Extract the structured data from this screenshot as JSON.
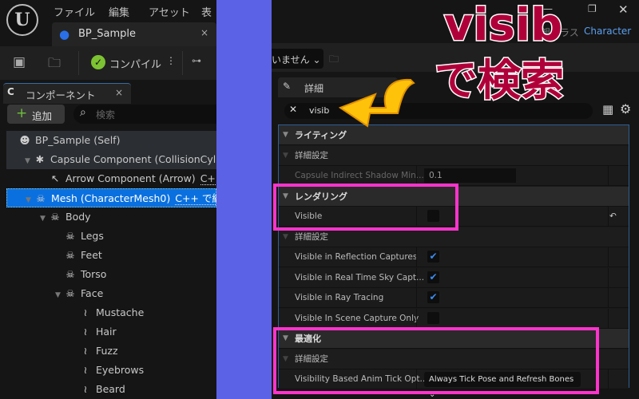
{
  "menu": [
    "ファイル",
    "編集",
    "アセット",
    "表示"
  ],
  "tab": {
    "title": "BP_Sample",
    "close": "×"
  },
  "toolbar": {
    "compile": "コンパイル",
    "more": "⋮",
    "dropdown": "いません"
  },
  "components": {
    "title": "コンポーネント",
    "close": "×",
    "add": "追加",
    "search_placeholder": "検索"
  },
  "tree": [
    {
      "label": "BP_Sample (Self)",
      "indent": 0,
      "icon": "person-icon"
    },
    {
      "label": "Capsule Component (CollisionCylinder)",
      "indent": 1,
      "icon": "capsule-icon",
      "tri": true
    },
    {
      "label": "Arrow Component (Arrow)",
      "indent": 2,
      "icon": "arrow-icon",
      "cpp": "C++ で編集"
    },
    {
      "label": "Mesh (CharacterMesh0)",
      "indent": 1,
      "icon": "skeleton-icon",
      "tri": true,
      "selected": true,
      "cpp": "C++ で編集"
    },
    {
      "label": "Body",
      "indent": 2,
      "icon": "skeleton-icon",
      "tri": true
    },
    {
      "label": "Legs",
      "indent": 3,
      "icon": "skeleton-icon"
    },
    {
      "label": "Feet",
      "indent": 3,
      "icon": "skeleton-icon"
    },
    {
      "label": "Torso",
      "indent": 3,
      "icon": "skeleton-icon"
    },
    {
      "label": "Face",
      "indent": 3,
      "icon": "skeleton-icon",
      "tri": true
    },
    {
      "label": "Mustache",
      "indent": 4,
      "icon": "hair-icon"
    },
    {
      "label": "Hair",
      "indent": 4,
      "icon": "hair-icon"
    },
    {
      "label": "Fuzz",
      "indent": 4,
      "icon": "hair-icon"
    },
    {
      "label": "Eyebrows",
      "indent": 4,
      "icon": "hair-icon"
    },
    {
      "label": "Beard",
      "indent": 4,
      "icon": "hair-icon"
    }
  ],
  "parent": {
    "label": "親クラス",
    "value": "Character"
  },
  "details": {
    "title": "詳細",
    "search_value": "visib"
  },
  "rows": [
    {
      "type": "cat",
      "label": "ライティング"
    },
    {
      "type": "sub",
      "label": "詳細設定"
    },
    {
      "type": "prop",
      "label": "Capsule Indirect Shadow Min...",
      "value": "0.1",
      "dim": true
    },
    {
      "type": "cat",
      "label": "レンダリング"
    },
    {
      "type": "prop",
      "label": "Visible",
      "check": false,
      "reset": true
    },
    {
      "type": "sub",
      "label": "詳細設定"
    },
    {
      "type": "prop",
      "label": "Visible in Reflection Captures",
      "check": true
    },
    {
      "type": "prop",
      "label": "Visible in Real Time Sky Capt...",
      "check": true
    },
    {
      "type": "prop",
      "label": "Visible in Ray Tracing",
      "check": true
    },
    {
      "type": "prop",
      "label": "Visible In Scene Capture Only",
      "check": false
    },
    {
      "type": "cat",
      "label": "最適化"
    },
    {
      "type": "sub",
      "label": "詳細設定"
    },
    {
      "type": "prop",
      "label": "Visibility Based Anim Tick Opt...",
      "select": "Always Tick Pose and Refresh Bones"
    }
  ],
  "annotation": {
    "line1": "visib",
    "line2": "で検索"
  },
  "colors": {
    "accent": "#0a70df",
    "highlight": "#ff33cc",
    "band": "#5c62e6"
  }
}
